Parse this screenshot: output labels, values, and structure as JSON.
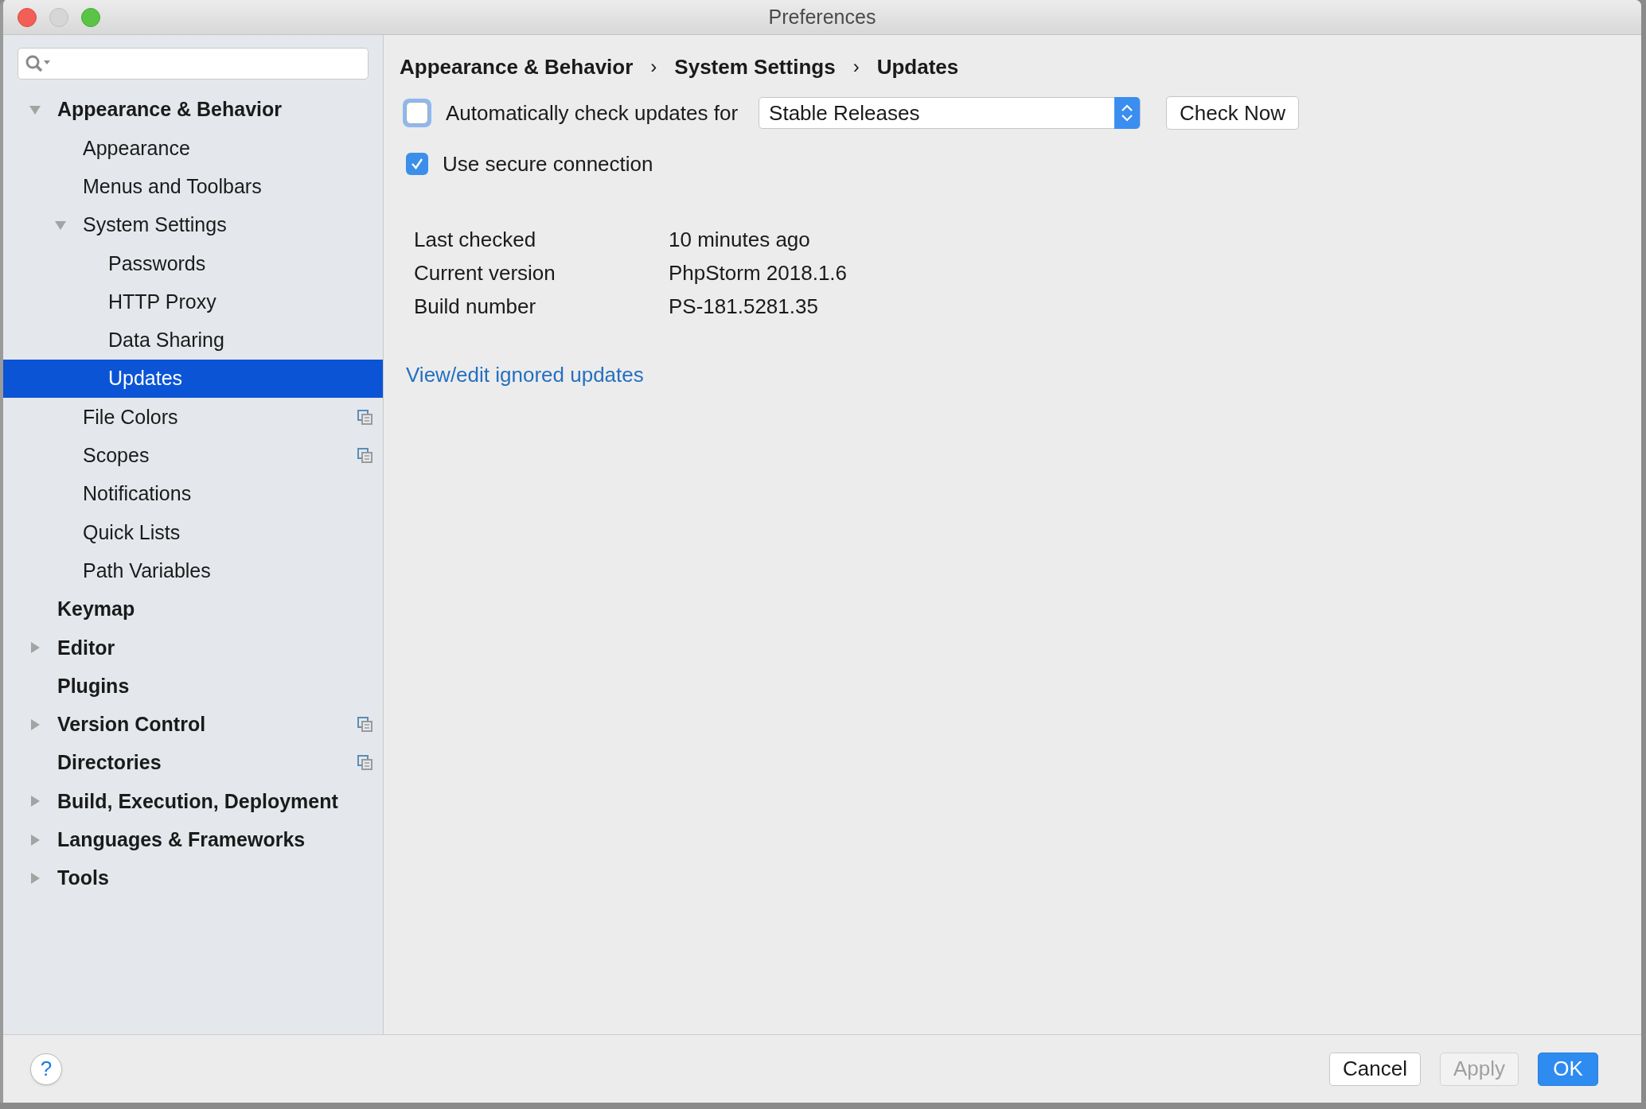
{
  "window": {
    "title": "Preferences"
  },
  "tree": [
    {
      "label": "Appearance & Behavior",
      "expanded": true,
      "selected": false,
      "children": [
        {
          "label": "Appearance",
          "selected": false
        },
        {
          "label": "Menus and Toolbars",
          "selected": false
        },
        {
          "label": "System Settings",
          "expanded": true,
          "selected": false,
          "children": [
            {
              "label": "Passwords",
              "selected": false
            },
            {
              "label": "HTTP Proxy",
              "selected": false
            },
            {
              "label": "Data Sharing",
              "selected": false
            },
            {
              "label": "Updates",
              "selected": true
            }
          ]
        },
        {
          "label": "File Colors",
          "selected": false,
          "project_level": true
        },
        {
          "label": "Scopes",
          "selected": false,
          "project_level": true
        },
        {
          "label": "Notifications",
          "selected": false
        },
        {
          "label": "Quick Lists",
          "selected": false
        },
        {
          "label": "Path Variables",
          "selected": false
        }
      ]
    },
    {
      "label": "Keymap",
      "selected": false
    },
    {
      "label": "Editor",
      "expanded": false,
      "selected": false
    },
    {
      "label": "Plugins",
      "selected": false
    },
    {
      "label": "Version Control",
      "expanded": false,
      "selected": false,
      "project_level": true
    },
    {
      "label": "Directories",
      "selected": false,
      "project_level": true
    },
    {
      "label": "Build, Execution, Deployment",
      "expanded": false,
      "selected": false
    },
    {
      "label": "Languages & Frameworks",
      "expanded": false,
      "selected": false
    },
    {
      "label": "Tools",
      "expanded": false,
      "selected": false
    }
  ],
  "breadcrumb": [
    "Appearance & Behavior",
    "System Settings",
    "Updates"
  ],
  "breadcrumb_separator": "›",
  "auto_check": {
    "label": "Automatically check updates for",
    "checked": false,
    "focused": true,
    "channel": "Stable Releases"
  },
  "check_now_button": "Check Now",
  "secure_connection": {
    "label": "Use secure connection",
    "checked": true
  },
  "info": [
    {
      "label": "Last checked",
      "value": "10 minutes ago"
    },
    {
      "label": "Current version",
      "value": "PhpStorm 2018.1.6"
    },
    {
      "label": "Build number",
      "value": "PS-181.5281.35"
    }
  ],
  "ignored_link": "View/edit ignored updates",
  "help_button": "?",
  "buttons": [
    {
      "label": "Cancel",
      "kind": "normal"
    },
    {
      "label": "Apply",
      "kind": "disabled"
    },
    {
      "label": "OK",
      "kind": "default"
    }
  ]
}
